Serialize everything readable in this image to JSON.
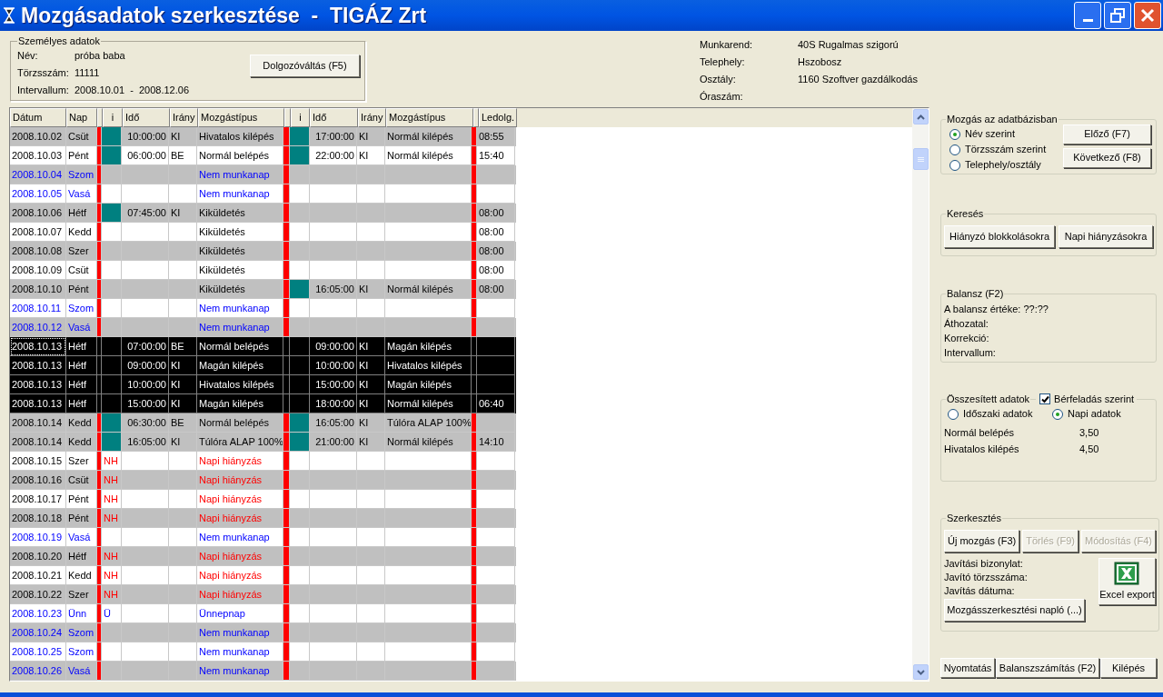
{
  "window": {
    "title": "Mozgásadatok szerkesztése  -  TIGÁZ Zrt"
  },
  "personal": {
    "title": "Személyes adatok",
    "fields": [
      {
        "label": "Név:",
        "value": "próba baba"
      },
      {
        "label": "Törzsszám:",
        "value": "11111"
      },
      {
        "label": "Intervallum:",
        "value": "2008.10.01  -  2008.12.06"
      }
    ],
    "button": "Dolgozóváltás (F5)"
  },
  "info": [
    {
      "label": "Munkarend:",
      "value": "40S Rugalmas szigorú"
    },
    {
      "label": "Telephely:",
      "value": "Hszobosz"
    },
    {
      "label": "Osztály:",
      "value": "1160 Szoftver gazdálkodás"
    },
    {
      "label": "Óraszám:"
    }
  ],
  "table": {
    "columns": [
      "Dátum",
      "Nap",
      "i",
      "Idő",
      "Irány",
      "Mozgástípus",
      "i",
      "Idő",
      "Irány",
      "Mozgástípus",
      "Ledolg."
    ],
    "rows": [
      {
        "date": "2008.10.02",
        "day": "Csüt",
        "kind": "workday",
        "shaded": true,
        "selected": false,
        "first": {
          "flag": true,
          "time": "10:00:00",
          "dir": "KI",
          "type": "Hivatalos kilépés"
        },
        "second": {
          "flag": true,
          "time": "17:00:00",
          "dir": "KI",
          "type": "Normál kilépés"
        },
        "worked": "08:55"
      },
      {
        "date": "2008.10.03",
        "day": "Pént",
        "kind": "workday",
        "shaded": false,
        "selected": false,
        "first": {
          "flag": true,
          "time": "06:00:00",
          "dir": "BE",
          "type": "Normál belépés"
        },
        "second": {
          "flag": true,
          "time": "22:00:00",
          "dir": "KI",
          "type": "Normál kilépés"
        },
        "worked": "15:40"
      },
      {
        "date": "2008.10.04",
        "day": "Szom",
        "kind": "nonwork",
        "shaded": true,
        "selected": false,
        "first": {
          "flag": false,
          "type": "Nem munkanap"
        },
        "second": {
          "flag": false
        }
      },
      {
        "date": "2008.10.05",
        "day": "Vasá",
        "kind": "nonwork",
        "shaded": false,
        "selected": false,
        "first": {
          "flag": false,
          "type": "Nem munkanap"
        },
        "second": {
          "flag": false
        }
      },
      {
        "date": "2008.10.06",
        "day": "Hétf",
        "kind": "workday",
        "shaded": true,
        "selected": false,
        "first": {
          "flag": true,
          "time": "07:45:00",
          "dir": "KI",
          "type": "Kiküldetés"
        },
        "second": {
          "flag": false
        },
        "worked": "08:00"
      },
      {
        "date": "2008.10.07",
        "day": "Kedd",
        "kind": "workday",
        "shaded": false,
        "selected": false,
        "first": {
          "flag": false,
          "type": "Kiküldetés"
        },
        "second": {
          "flag": false
        },
        "worked": "08:00"
      },
      {
        "date": "2008.10.08",
        "day": "Szer",
        "kind": "workday",
        "shaded": true,
        "selected": false,
        "first": {
          "flag": false,
          "type": "Kiküldetés"
        },
        "second": {
          "flag": false
        },
        "worked": "08:00"
      },
      {
        "date": "2008.10.09",
        "day": "Csüt",
        "kind": "workday",
        "shaded": false,
        "selected": false,
        "first": {
          "flag": false,
          "type": "Kiküldetés"
        },
        "second": {
          "flag": false
        },
        "worked": "08:00"
      },
      {
        "date": "2008.10.10",
        "day": "Pént",
        "kind": "workday",
        "shaded": true,
        "selected": false,
        "first": {
          "flag": false,
          "type": "Kiküldetés"
        },
        "second": {
          "flag": true,
          "time": "16:05:00",
          "dir": "KI",
          "type": "Normál kilépés"
        },
        "worked": "08:00"
      },
      {
        "date": "2008.10.11",
        "day": "Szom",
        "kind": "nonwork",
        "shaded": false,
        "selected": false,
        "first": {
          "flag": false,
          "type": "Nem munkanap"
        },
        "second": {
          "flag": false
        }
      },
      {
        "date": "2008.10.12",
        "day": "Vasá",
        "kind": "nonwork",
        "shaded": true,
        "selected": false,
        "first": {
          "flag": false,
          "type": "Nem munkanap"
        },
        "second": {
          "flag": false
        }
      },
      {
        "date": "2008.10.13",
        "day": "Hétf",
        "selected": true,
        "first": {
          "flag": false,
          "time": "07:00:00",
          "dir": "BE",
          "type": "Normál belépés"
        },
        "second": {
          "flag": false,
          "time": "09:00:00",
          "dir": "KI",
          "type": "Magán kilépés"
        }
      },
      {
        "date": "2008.10.13",
        "day": "Hétf",
        "selected": true,
        "first": {
          "flag": false,
          "time": "09:00:00",
          "dir": "KI",
          "type": "Magán kilépés"
        },
        "second": {
          "flag": false,
          "time": "10:00:00",
          "dir": "KI",
          "type": "Hivatalos kilépés"
        }
      },
      {
        "date": "2008.10.13",
        "day": "Hétf",
        "selected": true,
        "first": {
          "flag": false,
          "time": "10:00:00",
          "dir": "KI",
          "type": "Hivatalos kilépés"
        },
        "second": {
          "flag": false,
          "time": "15:00:00",
          "dir": "KI",
          "type": "Magán kilépés"
        }
      },
      {
        "date": "2008.10.13",
        "day": "Hétf",
        "selected": true,
        "first": {
          "flag": false,
          "time": "15:00:00",
          "dir": "KI",
          "type": "Magán kilépés"
        },
        "second": {
          "flag": false,
          "time": "18:00:00",
          "dir": "KI",
          "type": "Normál kilépés"
        },
        "worked": "06:40"
      },
      {
        "date": "2008.10.14",
        "day": "Kedd",
        "kind": "workday",
        "shaded": true,
        "selected": false,
        "first": {
          "flag": true,
          "time": "06:30:00",
          "dir": "BE",
          "type": "Normál belépés"
        },
        "second": {
          "flag": true,
          "time": "16:05:00",
          "dir": "KI",
          "type": "Túlóra ALAP 100%"
        }
      },
      {
        "date": "2008.10.14",
        "day": "Kedd",
        "kind": "workday",
        "shaded": true,
        "selected": false,
        "first": {
          "flag": true,
          "time": "16:05:00",
          "dir": "KI",
          "type": "Túlóra ALAP 100%"
        },
        "second": {
          "flag": true,
          "time": "21:00:00",
          "dir": "KI",
          "type": "Normál kilépés"
        },
        "worked": "14:10"
      },
      {
        "date": "2008.10.15",
        "day": "Szer",
        "kind": "absence",
        "shaded": false,
        "selected": false,
        "first": {
          "flag": false,
          "code": "NH",
          "type": "Napi hiányzás"
        },
        "second": {
          "flag": false
        }
      },
      {
        "date": "2008.10.16",
        "day": "Csüt",
        "kind": "absence",
        "shaded": true,
        "selected": false,
        "first": {
          "flag": false,
          "code": "NH",
          "type": "Napi hiányzás"
        },
        "second": {
          "flag": false
        }
      },
      {
        "date": "2008.10.17",
        "day": "Pént",
        "kind": "absence",
        "shaded": false,
        "selected": false,
        "first": {
          "flag": false,
          "code": "NH",
          "type": "Napi hiányzás"
        },
        "second": {
          "flag": false
        }
      },
      {
        "date": "2008.10.18",
        "day": "Pént",
        "kind": "absence",
        "shaded": true,
        "selected": false,
        "first": {
          "flag": false,
          "code": "NH",
          "type": "Napi hiányzás"
        },
        "second": {
          "flag": false
        }
      },
      {
        "date": "2008.10.19",
        "day": "Vasá",
        "kind": "nonwork",
        "shaded": false,
        "selected": false,
        "first": {
          "flag": false,
          "type": "Nem munkanap"
        },
        "second": {
          "flag": false
        }
      },
      {
        "date": "2008.10.20",
        "day": "Hétf",
        "kind": "absence",
        "shaded": true,
        "selected": false,
        "first": {
          "flag": false,
          "code": "NH",
          "type": "Napi hiányzás"
        },
        "second": {
          "flag": false
        }
      },
      {
        "date": "2008.10.21",
        "day": "Kedd",
        "kind": "absence",
        "shaded": false,
        "selected": false,
        "first": {
          "flag": false,
          "code": "NH",
          "type": "Napi hiányzás"
        },
        "second": {
          "flag": false
        }
      },
      {
        "date": "2008.10.22",
        "day": "Szer",
        "kind": "absence",
        "shaded": true,
        "selected": false,
        "first": {
          "flag": false,
          "code": "NH",
          "type": "Napi hiányzás"
        },
        "second": {
          "flag": false
        }
      },
      {
        "date": "2008.10.23",
        "day": "Ünn",
        "kind": "holiday",
        "shaded": false,
        "selected": false,
        "first": {
          "flag": false,
          "code": "Ü",
          "type": "Ünnepnap"
        },
        "second": {
          "flag": false
        }
      },
      {
        "date": "2008.10.24",
        "day": "Szom",
        "kind": "nonwork",
        "shaded": true,
        "selected": false,
        "first": {
          "flag": false,
          "type": "Nem munkanap"
        },
        "second": {
          "flag": false
        }
      },
      {
        "date": "2008.10.25",
        "day": "Szom",
        "kind": "nonwork",
        "shaded": false,
        "selected": false,
        "first": {
          "flag": false,
          "type": "Nem munkanap"
        },
        "second": {
          "flag": false
        }
      },
      {
        "date": "2008.10.26",
        "day": "Vasá",
        "kind": "nonwork",
        "shaded": true,
        "selected": false,
        "first": {
          "flag": false,
          "type": "Nem munkanap"
        },
        "second": {
          "flag": false
        }
      }
    ]
  },
  "navigation": {
    "title": "Mozgás az adatbázisban",
    "options": [
      {
        "label": "Név szerint",
        "selected": true
      },
      {
        "label": "Törzsszám szerint",
        "selected": false
      },
      {
        "label": "Telephely/osztály",
        "selected": false
      }
    ],
    "buttons": [
      {
        "label": "Előző (F7)",
        "disabled": false
      },
      {
        "label": "Következő (F8)",
        "disabled": false
      }
    ]
  },
  "search": {
    "title": "Keresés",
    "buttons": [
      {
        "label": "Hiányzó blokkolásokra",
        "disabled": false
      },
      {
        "label": "Napi hiányzásokra",
        "disabled": false
      }
    ]
  },
  "balance": {
    "title": "Balansz (F2)",
    "lines": [
      "A balansz értéke: ??:??",
      "Áthozatal:",
      "Korrekció:",
      "Intervallum:"
    ]
  },
  "summary": {
    "title": "Összesített adatok",
    "checkbox": {
      "label": "Bérfeladás szerint",
      "checked": true
    },
    "options": [
      {
        "label": "Időszaki adatok",
        "selected": false
      },
      {
        "label": "Napi adatok",
        "selected": true
      }
    ],
    "items": [
      {
        "label": "Normál belépés",
        "value": "3,50"
      },
      {
        "label": "Hivatalos kilépés",
        "value": "4,50"
      }
    ]
  },
  "editing": {
    "title": "Szerkesztés",
    "buttons": [
      {
        "label": "Új mozgás (F3)",
        "disabled": false
      },
      {
        "label": "Törlés (F9)",
        "disabled": true
      },
      {
        "label": "Módosítás (F4)",
        "disabled": true
      }
    ],
    "lines": [
      "Javítási bizonylat:",
      "Javító törzsszáma:",
      "Javítás dátuma:"
    ],
    "log_button": "Mozgásszerkesztési napló (...)",
    "export_button": "Excel export"
  },
  "bottom_buttons": [
    "Nyomtatás",
    "Balanszszámítás (F2)",
    "Kilépés"
  ]
}
